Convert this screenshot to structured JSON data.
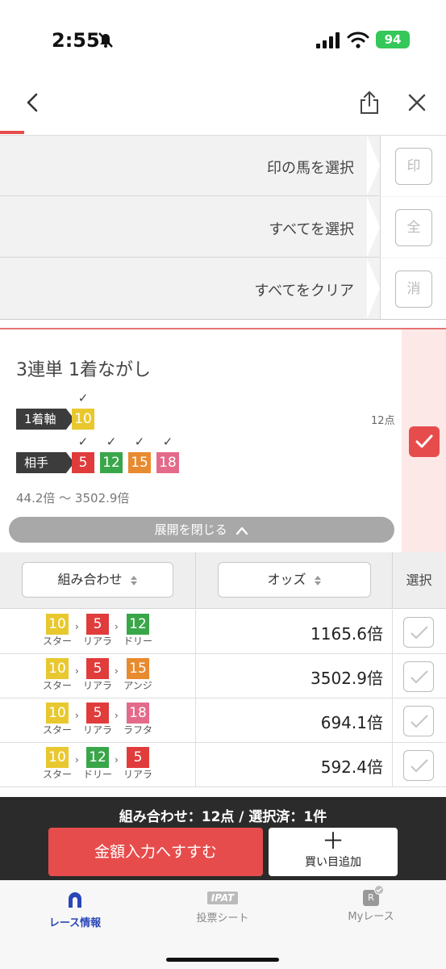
{
  "status": {
    "time": "2:55",
    "battery": "94"
  },
  "select_rows": [
    {
      "label": "印の馬を選択",
      "btn": "印"
    },
    {
      "label": "すべてを選択",
      "btn": "全"
    },
    {
      "label": "すべてをクリア",
      "btn": "消"
    }
  ],
  "bet": {
    "title": "3連単 1着ながし",
    "axis_label": "1着軸",
    "axis_horse": "10",
    "partner_label": "相手",
    "partners": [
      "5",
      "12",
      "15",
      "18"
    ],
    "check": "✓",
    "points": "12点",
    "odds_range": "44.2倍 〜 3502.9倍",
    "collapse_label": "展開を閉じる"
  },
  "table": {
    "col_combo": "組み合わせ",
    "col_odds": "オッズ",
    "col_select": "選択",
    "rows": [
      {
        "horses": [
          {
            "num": "10",
            "name": "スター"
          },
          {
            "num": "5",
            "name": "リアラ"
          },
          {
            "num": "12",
            "name": "ドリー"
          }
        ],
        "odds": "1165.6倍"
      },
      {
        "horses": [
          {
            "num": "10",
            "name": "スター"
          },
          {
            "num": "5",
            "name": "リアラ"
          },
          {
            "num": "15",
            "name": "アンジ"
          }
        ],
        "odds": "3502.9倍"
      },
      {
        "horses": [
          {
            "num": "10",
            "name": "スター"
          },
          {
            "num": "5",
            "name": "リアラ"
          },
          {
            "num": "18",
            "name": "ラフタ"
          }
        ],
        "odds": "694.1倍"
      },
      {
        "horses": [
          {
            "num": "10",
            "name": "スター"
          },
          {
            "num": "12",
            "name": "ドリー"
          },
          {
            "num": "5",
            "name": "リアラ"
          }
        ],
        "odds": "592.4倍"
      }
    ]
  },
  "bottom": {
    "summary": "組み合わせ：12点 / 選択済：1件",
    "proceed": "金額入力へすすむ",
    "add_plus": "＋",
    "add_label": "買い目追加"
  },
  "tabs": {
    "race_info": "レース情報",
    "ipat_badge": "IPAT",
    "ipat_sheet": "投票シート",
    "my_badge": "R",
    "my_race": "Myレース"
  },
  "colors": {
    "n10": "#e8c82e",
    "n5": "#e03c3c",
    "n12": "#3aa64a",
    "n15": "#e88a2e",
    "n18": "#e36a8a",
    "accent": "#e74c4c",
    "tab_active": "#2a47b8"
  }
}
